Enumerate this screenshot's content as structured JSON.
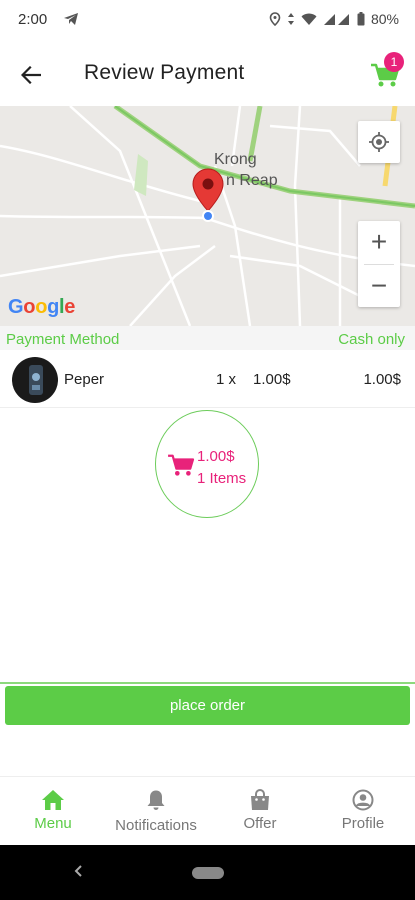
{
  "status_bar": {
    "time": "2:00",
    "battery": "80%"
  },
  "app_bar": {
    "title": "Review Payment",
    "cart_badge": "1"
  },
  "map": {
    "label_line1": "Krong",
    "label_line2": "n Reap",
    "zoom_in": "+",
    "zoom_out": "−",
    "logo_letters": [
      "G",
      "o",
      "o",
      "g",
      "l",
      "e"
    ]
  },
  "payment": {
    "label": "Payment Method",
    "value": "Cash only"
  },
  "order_item": {
    "name": "Peper",
    "quantity": "1 x",
    "price": "1.00$",
    "total": "1.00$"
  },
  "summary": {
    "total": "1.00$",
    "items": "1 Items"
  },
  "actions": {
    "place_order": "place order"
  },
  "bottom_nav": {
    "items": [
      {
        "label": "Menu",
        "icon": "home-icon",
        "active": true
      },
      {
        "label": "Notifications",
        "icon": "bell-icon",
        "active": false
      },
      {
        "label": "Offer",
        "icon": "shopping-bag-icon",
        "active": false
      },
      {
        "label": "Profile",
        "icon": "profile-icon",
        "active": false
      }
    ]
  },
  "colors": {
    "accent_green": "#5ccc47",
    "accent_pink": "#e8227a"
  }
}
